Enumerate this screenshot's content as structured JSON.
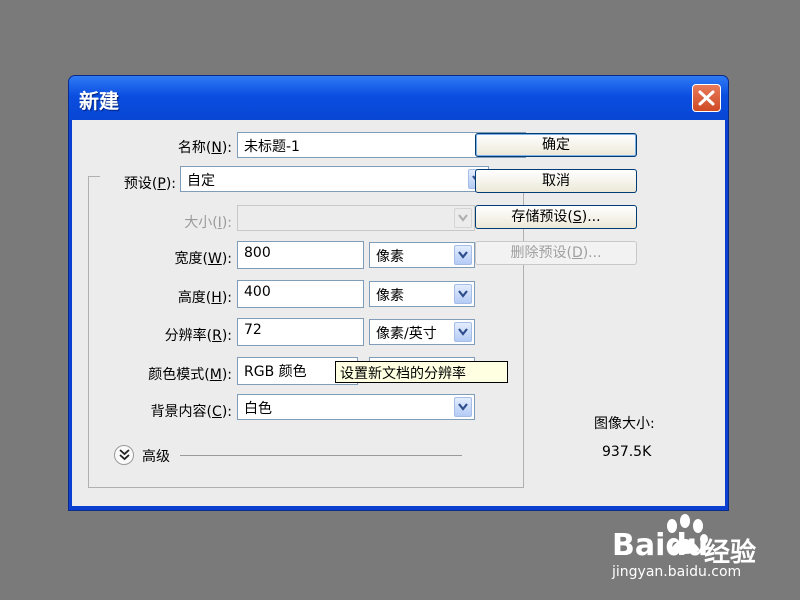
{
  "dialog": {
    "title": "新建",
    "name_label_pre": "名称(",
    "name_label_key": "N",
    "name_label_post": "):",
    "name_value": "未标题-1",
    "preset_label_pre": "预设(",
    "preset_label_key": "P",
    "preset_label_post": "):",
    "preset_value": "自定",
    "size_label_pre": "大小(",
    "size_label_key": "I",
    "size_label_post": "):",
    "size_value": "",
    "width_label_pre": "宽度(",
    "width_label_key": "W",
    "width_label_post": "):",
    "width_value": "800",
    "width_unit": "像素",
    "height_label_pre": "高度(",
    "height_label_key": "H",
    "height_label_post": "):",
    "height_value": "400",
    "height_unit": "像素",
    "resolution_label_pre": "分辨率(",
    "resolution_label_key": "R",
    "resolution_label_post": "):",
    "resolution_value": "72",
    "resolution_unit": "像素/英寸",
    "mode_label_pre": "颜色模式(",
    "mode_label_key": "M",
    "mode_label_post": "):",
    "mode_value": "RGB 颜色",
    "background_label_pre": "背景内容(",
    "background_label_key": "C",
    "background_label_post": "):",
    "background_value": "白色",
    "advanced_label": "高级",
    "image_size_label": "图像大小:",
    "image_size_value": "937.5K",
    "tooltip": "设置新文档的分辨率"
  },
  "buttons": {
    "ok": "确定",
    "cancel": "取消",
    "save_preset_pre": "存储预设(",
    "save_preset_key": "S",
    "save_preset_post": ")...",
    "delete_preset_pre": "删除预设(",
    "delete_preset_key": "D",
    "delete_preset_post": ")..."
  },
  "watermark": {
    "brand": "Baidu",
    "product": "经验",
    "url": "jingyan.baidu.com"
  },
  "icons": {
    "close": "close-icon",
    "dropdown": "chevron-down-icon",
    "advanced": "double-chevron-down-icon",
    "paw": "paw-icon"
  },
  "colors": {
    "titlebar": "#0a4ee0",
    "dialog_bg": "#ececec",
    "desktop": "#7a7a7a",
    "tooltip_bg": "#ffffe1"
  }
}
